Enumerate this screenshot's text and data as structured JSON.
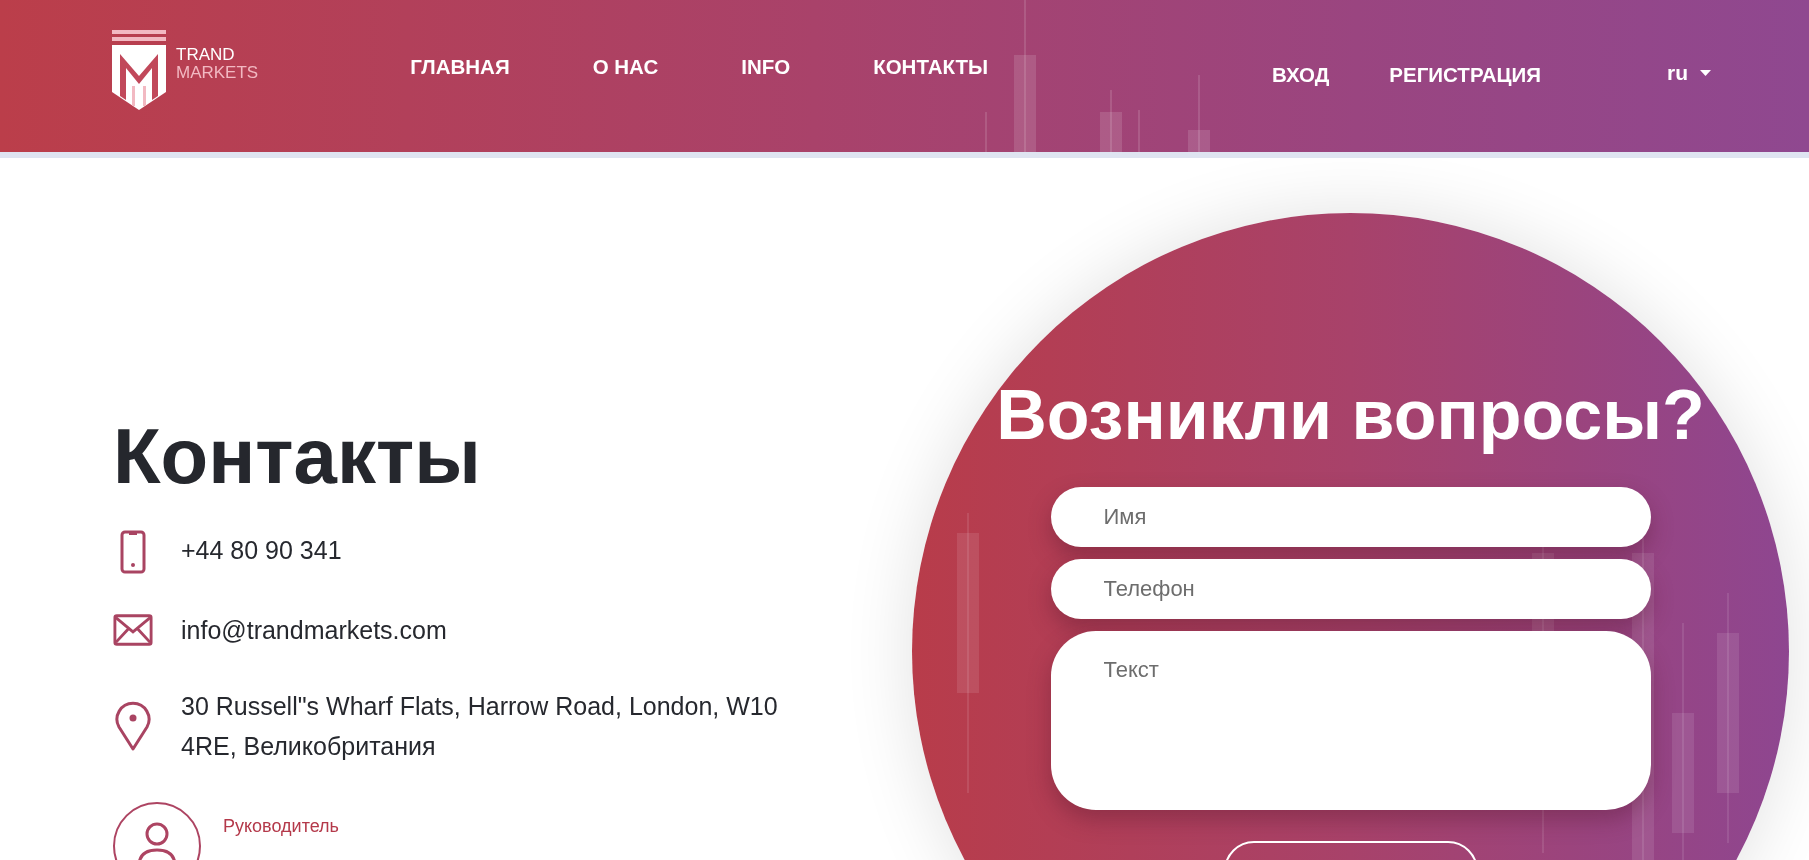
{
  "header": {
    "logo": {
      "line_1": "TRAND",
      "line_2": "MARKETS"
    },
    "nav": [
      {
        "label": "ГЛАВНАЯ"
      },
      {
        "label": "О НАС"
      },
      {
        "label": "INFO"
      },
      {
        "label": "КОНТАКТЫ"
      }
    ],
    "auth": [
      {
        "label": "ВХОД"
      },
      {
        "label": "РЕГИСТРАЦИЯ"
      }
    ],
    "language": {
      "value": "ru"
    }
  },
  "contacts": {
    "title": "Контакты",
    "items": [
      {
        "kind": "phone",
        "text": "+44 80 90 341"
      },
      {
        "kind": "email",
        "text": "info@trandmarkets.com"
      },
      {
        "kind": "address",
        "text": "30 Russell\"s Wharf Flats, Harrow Road, London, W10 4RE, Великобритания"
      }
    ],
    "manager": {
      "role": "Руководитель"
    }
  },
  "form": {
    "title": "Возникли вопросы?",
    "fields": [
      {
        "kind": "input",
        "placeholder": "Имя"
      },
      {
        "kind": "input",
        "placeholder": "Телефон"
      },
      {
        "kind": "textarea",
        "placeholder": "Текст"
      }
    ]
  }
}
